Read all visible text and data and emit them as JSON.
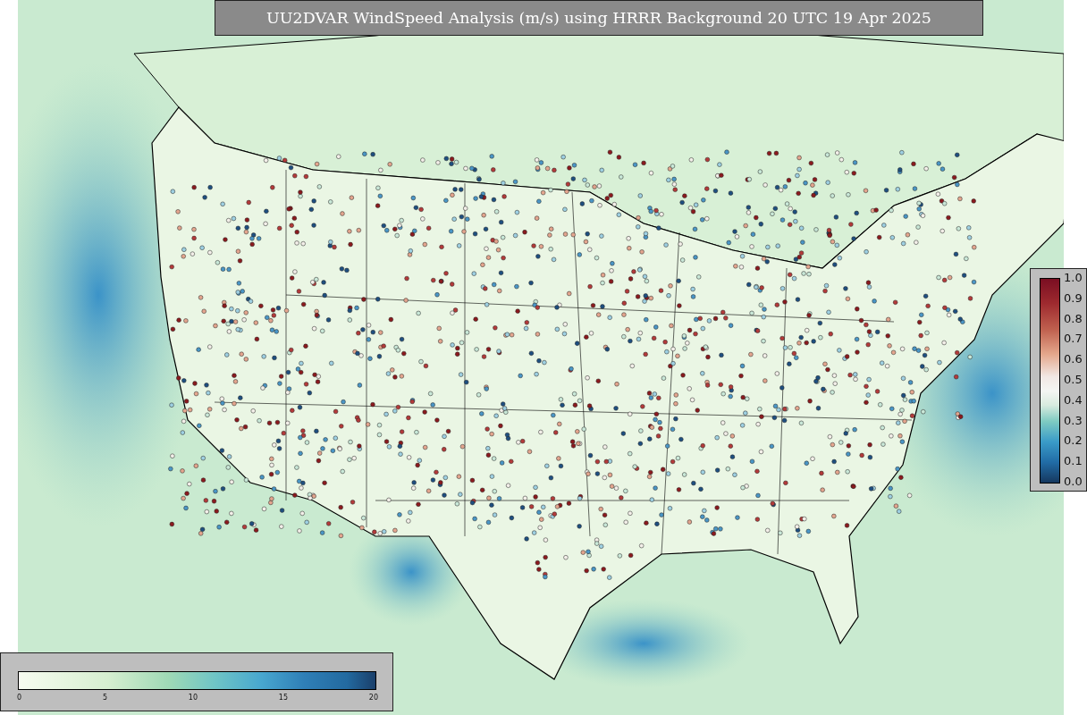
{
  "title": "UU2DVAR WindSpeed Analysis (m/s) using HRRR Background 20 UTC 19 Apr 2025",
  "ratio_colorbar": {
    "ticks": [
      "1.0",
      "0.9",
      "0.8",
      "0.7",
      "0.6",
      "0.5",
      "0.4",
      "0.3",
      "0.2",
      "0.1",
      "0.0"
    ]
  },
  "wind_colorbar": {
    "ticks": [
      "0",
      "5",
      "10",
      "15",
      "20"
    ]
  }
}
